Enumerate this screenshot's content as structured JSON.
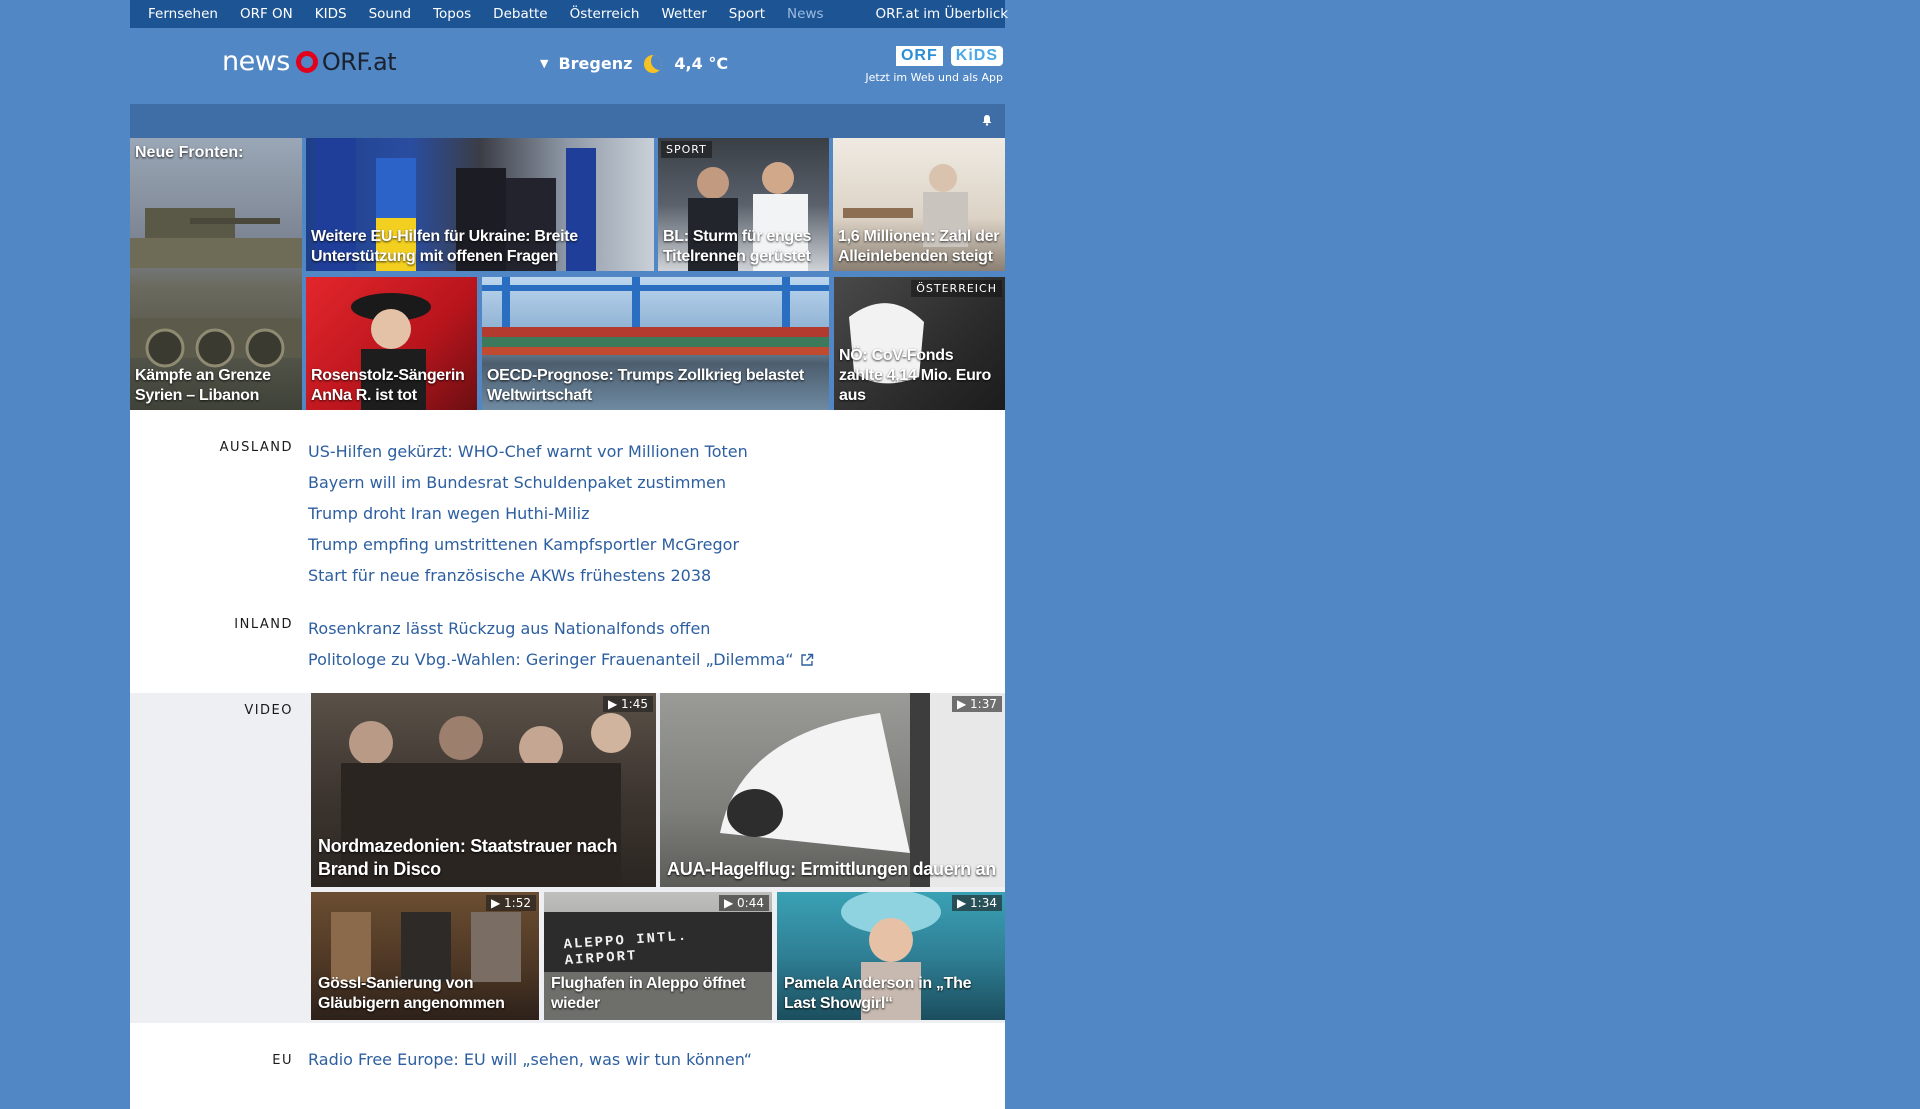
{
  "topnav": {
    "items": [
      "Fernsehen",
      "ORF ON",
      "KIDS",
      "Sound",
      "Topos",
      "Debatte",
      "Österreich",
      "Wetter",
      "Sport",
      "News"
    ],
    "active": "News",
    "overview": "ORF.at im Überblick"
  },
  "header": {
    "logo_news": "news",
    "logo_orfat": "ORF.at",
    "weather": {
      "city": "Bregenz",
      "temp": "4,4 °C",
      "icon": "moon-icon"
    },
    "kids": {
      "orf": "ORF",
      "kids": "KiDS",
      "tagline": "Jetzt im Web und als App"
    }
  },
  "tiles": [
    {
      "top_caption": "Neue Fronten:",
      "caption": "Kämpfe an Grenze Syrien – Libanon"
    },
    {
      "caption": "Weitere EU-Hilfen für Ukraine: Breite Unterstützung mit offenen Fragen"
    },
    {
      "tag": "SPORT",
      "caption": "BL: Sturm für enges Titelrennen gerüstet"
    },
    {
      "caption": "1,6 Millionen: Zahl der Alleinlebenden steigt"
    },
    {
      "caption": "Rosenstolz-Sängerin AnNa R. ist tot"
    },
    {
      "caption": "OECD-Prognose: Trumps Zollkrieg belastet Weltwirtschaft"
    },
    {
      "tag": "ÖSTERREICH",
      "caption": "NÖ: CoV-Fonds zahlte 4,14 Mio. Euro aus"
    }
  ],
  "sections": {
    "ausland": {
      "label": "AUSLAND",
      "links": [
        "US-Hilfen gekürzt: WHO-Chef warnt vor Millionen Toten",
        "Bayern will im Bundesrat Schuldenpaket zustimmen",
        "Trump droht Iran wegen Huthi-Miliz",
        "Trump empfing umstrittenen Kampfsportler McGregor",
        "Start für neue französische AKWs frühestens 2038"
      ]
    },
    "inland": {
      "label": "INLAND",
      "links": [
        "Rosenkranz lässt Rückzug aus Nationalfonds offen",
        "Politologe zu Vbg.-Wahlen: Geringer Frauenanteil „Dilemma“"
      ]
    },
    "video": {
      "label": "VIDEO",
      "items": [
        {
          "duration": "1:45",
          "caption": "Nordmazedonien: Staatstrauer nach Brand in Disco"
        },
        {
          "duration": "1:37",
          "caption": "AUA-Hagelflug: Ermittlungen dauern an"
        },
        {
          "duration": "1:52",
          "caption": "Gössl-Sanierung von Gläubigern angenommen"
        },
        {
          "duration": "0:44",
          "caption": "Flughafen in Aleppo öffnet wieder",
          "sign": "ALEPPO INTL. AIRPORT"
        },
        {
          "duration": "1:34",
          "caption": "Pamela Anderson in „The Last Showgirl“"
        }
      ]
    },
    "eu": {
      "label": "EU",
      "links": [
        "Radio Free Europe: EU will „sehen, was wir tun können“"
      ]
    }
  }
}
